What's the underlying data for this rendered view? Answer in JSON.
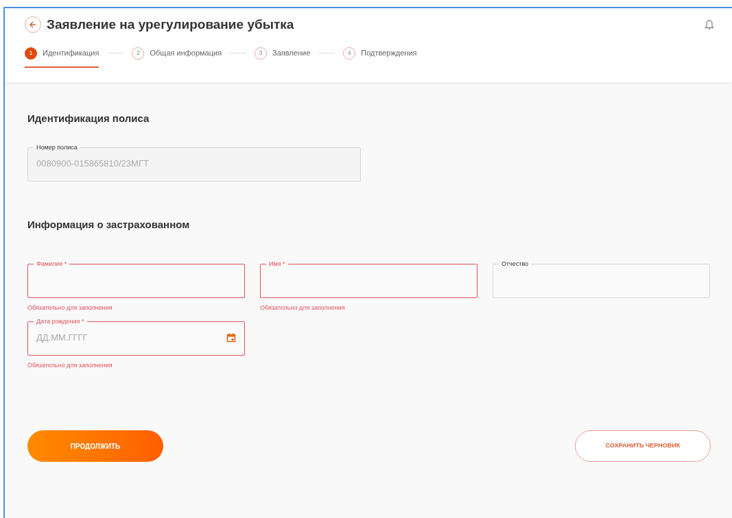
{
  "header": {
    "title": "Заявление на урегулирование убытка"
  },
  "steps": [
    {
      "number": "1",
      "label": "Идентификация",
      "selected": true
    },
    {
      "number": "2",
      "label": "Общая информация",
      "selected": false
    },
    {
      "number": "3",
      "label": "Заявление",
      "selected": false
    },
    {
      "number": "4",
      "label": "Подтверждения",
      "selected": false
    }
  ],
  "sections": [
    {
      "title": "Идентификация полиса",
      "fields": [
        {
          "label": "Номер полиса",
          "value": "0080900-015865810/23МГТ",
          "disabled": true,
          "invalid": false,
          "kind": "text"
        }
      ]
    },
    {
      "title": "Информация о застрахованном",
      "fields": [
        {
          "label": "Фамилия *",
          "invalid": true,
          "error": "Обязательно для заполнения",
          "kind": "text"
        },
        {
          "label": "Имя *",
          "invalid": true,
          "error": "Обязательно для заполнения",
          "kind": "text"
        },
        {
          "label": "Отчество",
          "invalid": false,
          "kind": "text"
        },
        {
          "label": "Дата рождения *",
          "placeholder": "ДД.ММ.ГГГГ",
          "invalid": true,
          "error": "Обязательно для заполнения",
          "kind": "date"
        }
      ]
    }
  ],
  "actions": {
    "primary": "ПРОДОЛЖИТЬ",
    "secondary": "СОХРАНИТЬ ЧЕРНОВИК"
  }
}
